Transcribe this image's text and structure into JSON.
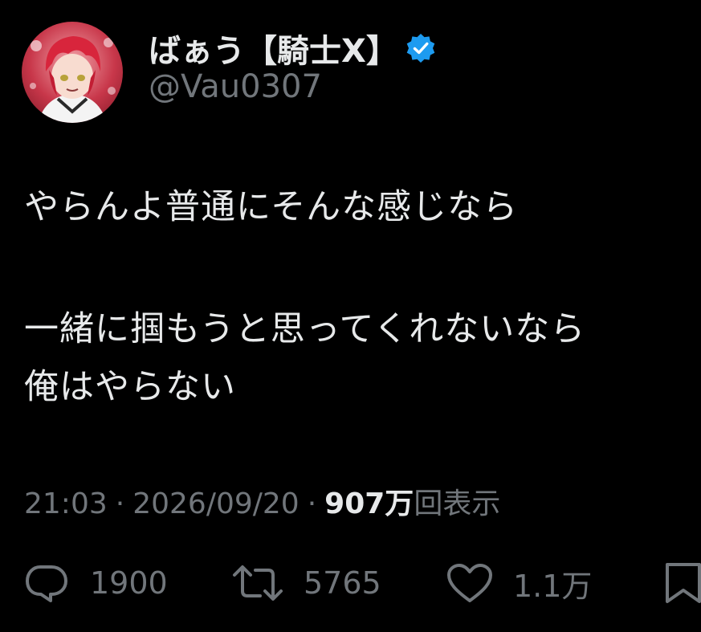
{
  "user": {
    "display_name": "ばぁう【騎士X】",
    "handle": "@Vau0307",
    "verified": true,
    "avatar_icon": "profile-avatar"
  },
  "tweet": {
    "lines": [
      "やらんよ普通にそんな感じなら",
      "一緒に掴もうと思ってくれないなら",
      "俺はやらない"
    ]
  },
  "meta": {
    "time": "21:03",
    "separator": "·",
    "date": "2026/09/20",
    "views_count": "907万",
    "views_label": "回表示"
  },
  "actions": {
    "replies": "1900",
    "retweets": "5765",
    "likes": "1.1万"
  },
  "colors": {
    "background": "#000000",
    "text_primary": "#e7e9ea",
    "text_secondary": "#71767b",
    "verified_blue": "#1d9bf0"
  }
}
